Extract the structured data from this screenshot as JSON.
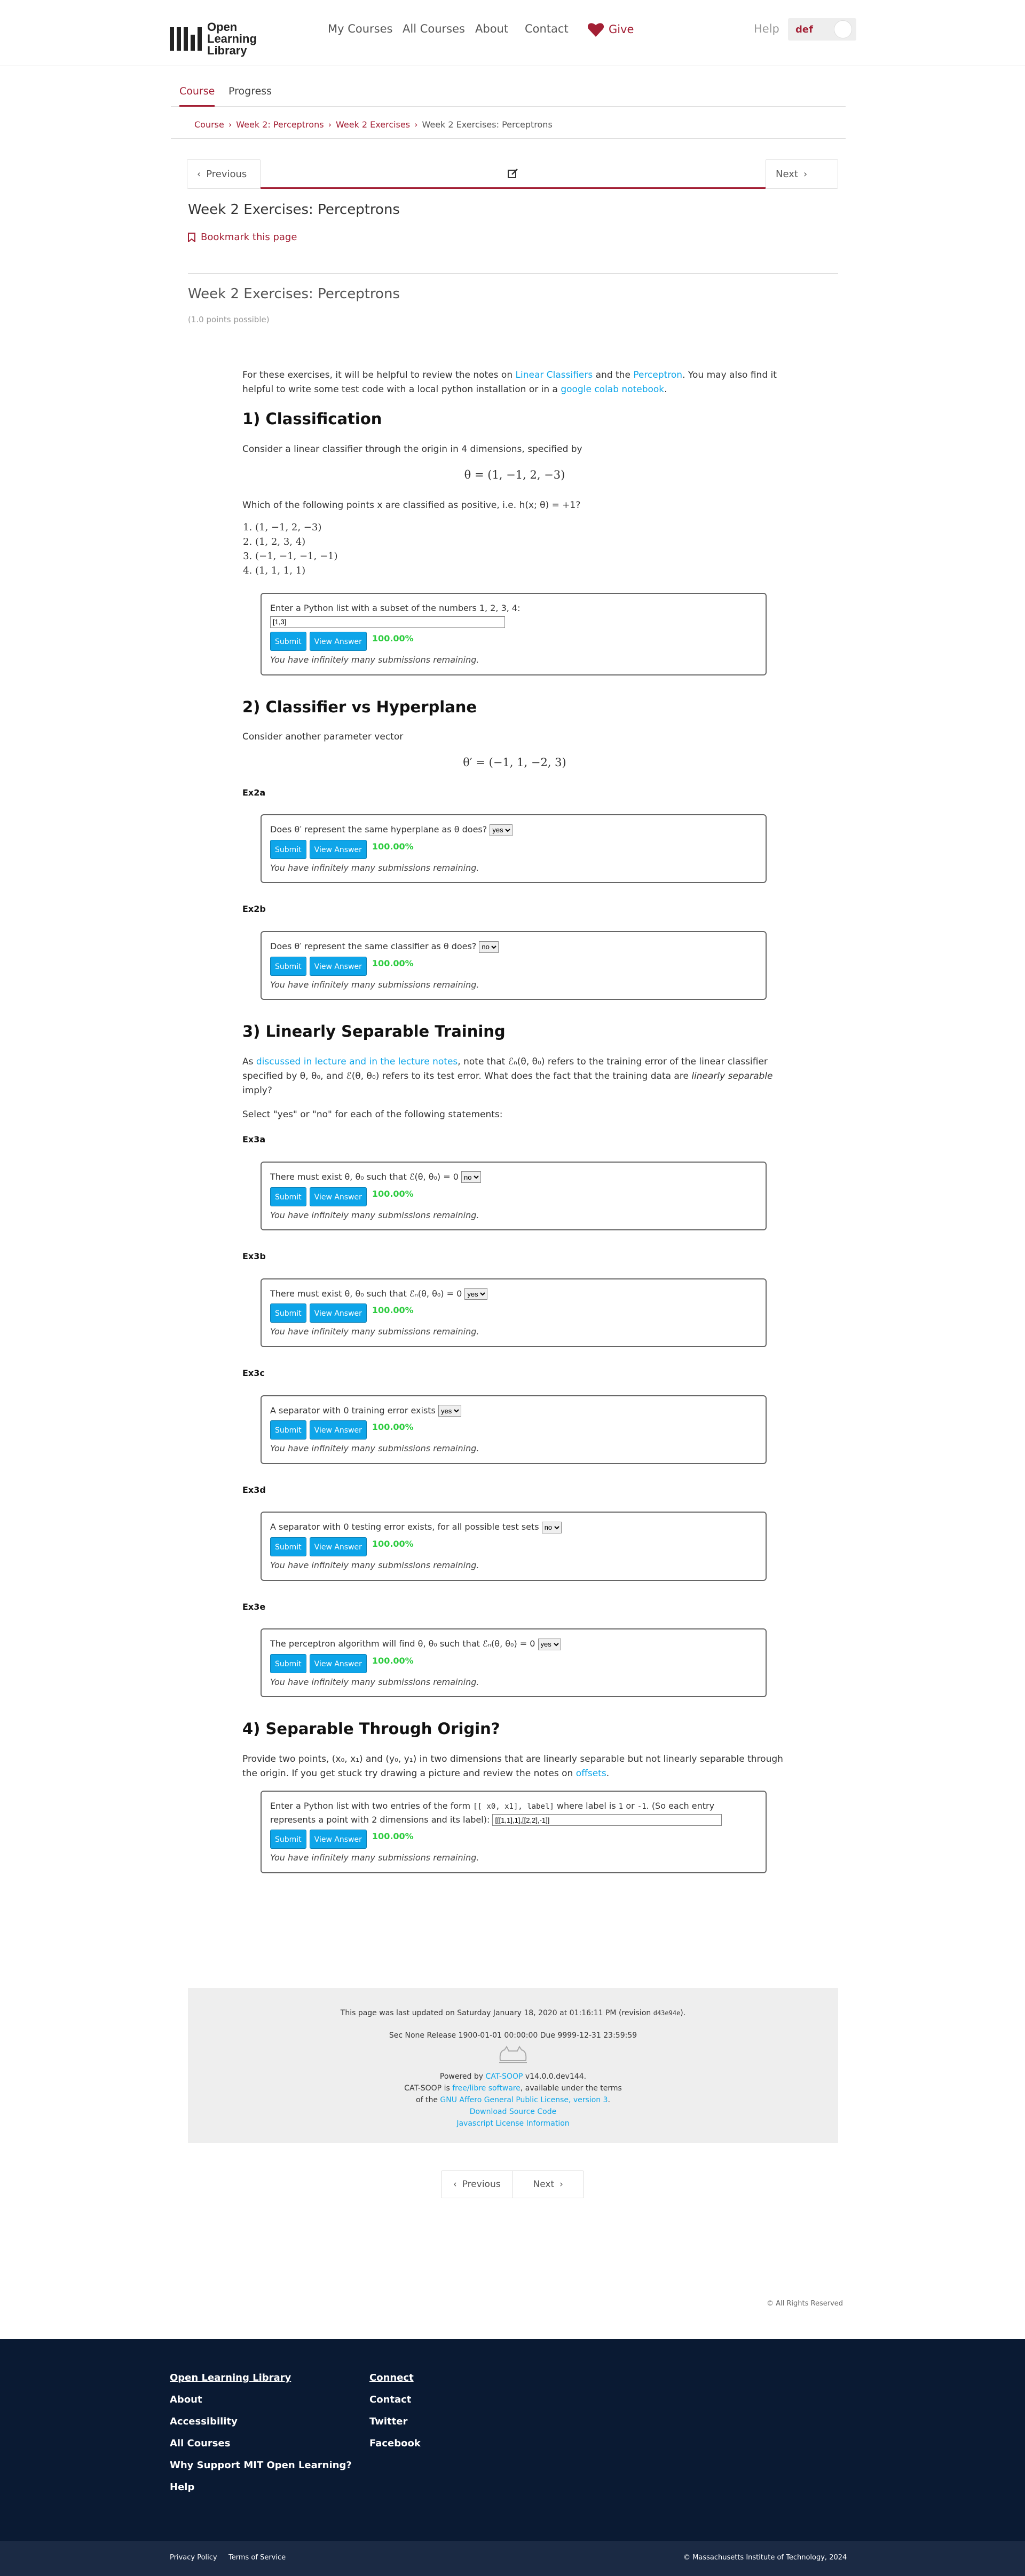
{
  "header": {
    "logo_text": "Open Learning Library",
    "nav": [
      "My Courses",
      "All Courses",
      "About",
      "Contact"
    ],
    "give_label": "Give",
    "help_label": "Help",
    "username": "def"
  },
  "course_tabs": [
    "Course",
    "Progress"
  ],
  "breadcrumb": [
    "Course",
    "Week 2: Perceptrons",
    "Week 2 Exercises",
    "Week 2 Exercises: Perceptrons"
  ],
  "seqnav": {
    "previous": "Previous",
    "next": "Next"
  },
  "unit_title": "Week 2 Exercises: Perceptrons",
  "bookmark_label": "Bookmark this page",
  "problem": {
    "title": "Week 2 Exercises: Perceptrons",
    "points": "(1.0 points possible)"
  },
  "intro": {
    "pre": "For these exercises, it will be helpful to review the notes on ",
    "link1": "Linear Classifiers",
    "mid": " and the ",
    "link2": "Perceptron",
    "post": ". You may also find it helpful to write some test code with a local python installation or in a ",
    "link3": "google colab notebook",
    "end": "."
  },
  "s1": {
    "title": "1) Classification",
    "text": "Consider a linear classifier through the origin in 4 dimensions, specified by",
    "eq": "θ = (1, −1, 2, −3)",
    "question": "Which of the following points x are classified as positive, i.e. h(x; θ) = +1?",
    "points": [
      "(1, −1, 2, −3)",
      "(1, 2, 3, 4)",
      "(−1, −1, −1, −1)",
      "(1, 1, 1, 1)"
    ],
    "prompt": "Enter a Python list with a subset of the numbers 1, 2, 3, 4:",
    "answer": "[1,3]"
  },
  "buttons": {
    "submit": "Submit",
    "view": "View Answer",
    "score": "100.00%",
    "remaining": "You have infinitely many submissions remaining."
  },
  "s2": {
    "title": "2) Classifier vs Hyperplane",
    "text": "Consider another parameter vector",
    "eq": "θ′ = (−1, 1, −2, 3)",
    "ex2a_label": "Ex2a",
    "ex2a_q": "Does θ′ represent the same hyperplane as θ does?",
    "ex2a_val": "yes",
    "ex2b_label": "Ex2b",
    "ex2b_q": "Does θ′ represent the same classifier as θ does?",
    "ex2b_val": "no"
  },
  "s3": {
    "title": "3) Linearly Separable Training",
    "p_pre": "As ",
    "p_link": "discussed in lecture and in the lecture notes",
    "p_post": ", note that ℰₙ(θ, θ₀) refers to the training error of the linear classifier specified by θ, θ₀, and ℰ(θ, θ₀) refers to its test error. What does the fact that the training data are ",
    "p_em": "linearly separable",
    "p_end": " imply?",
    "instr": "Select \"yes\" or \"no\" for each of the following statements:",
    "items": [
      {
        "label": "Ex3a",
        "q": "There must exist θ, θ₀ such that ℰ(θ, θ₀) = 0",
        "val": "no"
      },
      {
        "label": "Ex3b",
        "q": "There must exist θ, θ₀ such that ℰₙ(θ, θ₀) = 0",
        "val": "yes"
      },
      {
        "label": "Ex3c",
        "q": "A separator with 0 training error exists",
        "val": "yes"
      },
      {
        "label": "Ex3d",
        "q": "A separator with 0 testing error exists, for all possible test sets",
        "val": "no"
      },
      {
        "label": "Ex3e",
        "q": "The perceptron algorithm will find θ, θ₀ such that ℰₙ(θ, θ₀) = 0",
        "val": "yes"
      }
    ]
  },
  "s4": {
    "title": "4) Separable Through Origin?",
    "p_pre": "Provide two points, (x₀, x₁) and (y₀, y₁) in two dimensions that are linearly separable but not linearly separable through the origin. If you get stuck try drawing a picture and review the notes on ",
    "p_link": "offsets",
    "p_end": ".",
    "prompt_pre": "Enter a Python list with two entries of the form ",
    "prompt_code": "[[ x0, x1], label]",
    "prompt_mid": " where label is ",
    "prompt_code2": "1",
    "prompt_or": " or ",
    "prompt_code3": "-1",
    "prompt_post": ". (So each entry represents a point with 2 dimensions and its label):",
    "answer": "[[[1,1],1],[[2,2],-1]]"
  },
  "meta": {
    "updated": "This page was last updated on Saturday January 18, 2020 at 01:16:11 PM (revision ",
    "revision": "d43e94e",
    "updated_end": ").",
    "release": "Sec None Release 1900-01-01 00:00:00 Due 9999-12-31 23:59:59",
    "powered_pre": "Powered by ",
    "powered_link": "CAT-SOOP",
    "powered_post": " v14.0.0.dev144.",
    "free_pre": "CAT-SOOP is ",
    "free_link": "free/libre software",
    "free_post": ", available under the terms",
    "license_pre": "of the ",
    "license_link": "GNU Affero General Public License, version 3",
    "license_post": ".",
    "download": "Download Source Code",
    "jslicense": "Javascript License Information"
  },
  "bottomnav": {
    "previous": "Previous",
    "next": "Next"
  },
  "rights": "© All Rights Reserved",
  "footer": {
    "col1": [
      "Open Learning Library",
      "About",
      "Accessibility",
      "All Courses",
      "Why Support MIT Open Learning?",
      "Help"
    ],
    "col2": [
      "Connect",
      "Contact",
      "Twitter",
      "Facebook"
    ],
    "privacy": "Privacy Policy",
    "terms": "Terms of Service",
    "copyright": "© Massachusetts Institute of Technology, 2024"
  }
}
